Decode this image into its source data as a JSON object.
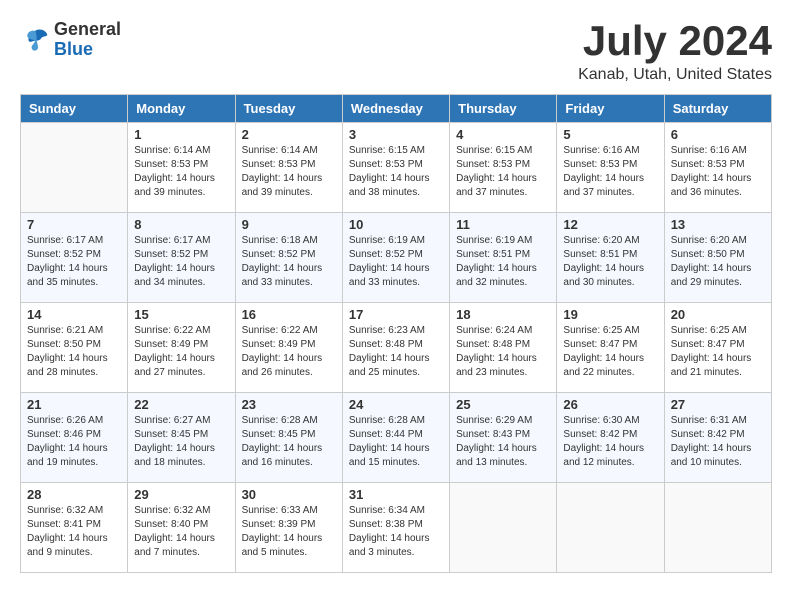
{
  "header": {
    "logo_general": "General",
    "logo_blue": "Blue",
    "title": "July 2024",
    "location": "Kanab, Utah, United States"
  },
  "days_of_week": [
    "Sunday",
    "Monday",
    "Tuesday",
    "Wednesday",
    "Thursday",
    "Friday",
    "Saturday"
  ],
  "weeks": [
    [
      {
        "day": "",
        "sunrise": "",
        "sunset": "",
        "daylight": ""
      },
      {
        "day": "1",
        "sunrise": "Sunrise: 6:14 AM",
        "sunset": "Sunset: 8:53 PM",
        "daylight": "Daylight: 14 hours and 39 minutes."
      },
      {
        "day": "2",
        "sunrise": "Sunrise: 6:14 AM",
        "sunset": "Sunset: 8:53 PM",
        "daylight": "Daylight: 14 hours and 39 minutes."
      },
      {
        "day": "3",
        "sunrise": "Sunrise: 6:15 AM",
        "sunset": "Sunset: 8:53 PM",
        "daylight": "Daylight: 14 hours and 38 minutes."
      },
      {
        "day": "4",
        "sunrise": "Sunrise: 6:15 AM",
        "sunset": "Sunset: 8:53 PM",
        "daylight": "Daylight: 14 hours and 37 minutes."
      },
      {
        "day": "5",
        "sunrise": "Sunrise: 6:16 AM",
        "sunset": "Sunset: 8:53 PM",
        "daylight": "Daylight: 14 hours and 37 minutes."
      },
      {
        "day": "6",
        "sunrise": "Sunrise: 6:16 AM",
        "sunset": "Sunset: 8:53 PM",
        "daylight": "Daylight: 14 hours and 36 minutes."
      }
    ],
    [
      {
        "day": "7",
        "sunrise": "Sunrise: 6:17 AM",
        "sunset": "Sunset: 8:52 PM",
        "daylight": "Daylight: 14 hours and 35 minutes."
      },
      {
        "day": "8",
        "sunrise": "Sunrise: 6:17 AM",
        "sunset": "Sunset: 8:52 PM",
        "daylight": "Daylight: 14 hours and 34 minutes."
      },
      {
        "day": "9",
        "sunrise": "Sunrise: 6:18 AM",
        "sunset": "Sunset: 8:52 PM",
        "daylight": "Daylight: 14 hours and 33 minutes."
      },
      {
        "day": "10",
        "sunrise": "Sunrise: 6:19 AM",
        "sunset": "Sunset: 8:52 PM",
        "daylight": "Daylight: 14 hours and 33 minutes."
      },
      {
        "day": "11",
        "sunrise": "Sunrise: 6:19 AM",
        "sunset": "Sunset: 8:51 PM",
        "daylight": "Daylight: 14 hours and 32 minutes."
      },
      {
        "day": "12",
        "sunrise": "Sunrise: 6:20 AM",
        "sunset": "Sunset: 8:51 PM",
        "daylight": "Daylight: 14 hours and 30 minutes."
      },
      {
        "day": "13",
        "sunrise": "Sunrise: 6:20 AM",
        "sunset": "Sunset: 8:50 PM",
        "daylight": "Daylight: 14 hours and 29 minutes."
      }
    ],
    [
      {
        "day": "14",
        "sunrise": "Sunrise: 6:21 AM",
        "sunset": "Sunset: 8:50 PM",
        "daylight": "Daylight: 14 hours and 28 minutes."
      },
      {
        "day": "15",
        "sunrise": "Sunrise: 6:22 AM",
        "sunset": "Sunset: 8:49 PM",
        "daylight": "Daylight: 14 hours and 27 minutes."
      },
      {
        "day": "16",
        "sunrise": "Sunrise: 6:22 AM",
        "sunset": "Sunset: 8:49 PM",
        "daylight": "Daylight: 14 hours and 26 minutes."
      },
      {
        "day": "17",
        "sunrise": "Sunrise: 6:23 AM",
        "sunset": "Sunset: 8:48 PM",
        "daylight": "Daylight: 14 hours and 25 minutes."
      },
      {
        "day": "18",
        "sunrise": "Sunrise: 6:24 AM",
        "sunset": "Sunset: 8:48 PM",
        "daylight": "Daylight: 14 hours and 23 minutes."
      },
      {
        "day": "19",
        "sunrise": "Sunrise: 6:25 AM",
        "sunset": "Sunset: 8:47 PM",
        "daylight": "Daylight: 14 hours and 22 minutes."
      },
      {
        "day": "20",
        "sunrise": "Sunrise: 6:25 AM",
        "sunset": "Sunset: 8:47 PM",
        "daylight": "Daylight: 14 hours and 21 minutes."
      }
    ],
    [
      {
        "day": "21",
        "sunrise": "Sunrise: 6:26 AM",
        "sunset": "Sunset: 8:46 PM",
        "daylight": "Daylight: 14 hours and 19 minutes."
      },
      {
        "day": "22",
        "sunrise": "Sunrise: 6:27 AM",
        "sunset": "Sunset: 8:45 PM",
        "daylight": "Daylight: 14 hours and 18 minutes."
      },
      {
        "day": "23",
        "sunrise": "Sunrise: 6:28 AM",
        "sunset": "Sunset: 8:45 PM",
        "daylight": "Daylight: 14 hours and 16 minutes."
      },
      {
        "day": "24",
        "sunrise": "Sunrise: 6:28 AM",
        "sunset": "Sunset: 8:44 PM",
        "daylight": "Daylight: 14 hours and 15 minutes."
      },
      {
        "day": "25",
        "sunrise": "Sunrise: 6:29 AM",
        "sunset": "Sunset: 8:43 PM",
        "daylight": "Daylight: 14 hours and 13 minutes."
      },
      {
        "day": "26",
        "sunrise": "Sunrise: 6:30 AM",
        "sunset": "Sunset: 8:42 PM",
        "daylight": "Daylight: 14 hours and 12 minutes."
      },
      {
        "day": "27",
        "sunrise": "Sunrise: 6:31 AM",
        "sunset": "Sunset: 8:42 PM",
        "daylight": "Daylight: 14 hours and 10 minutes."
      }
    ],
    [
      {
        "day": "28",
        "sunrise": "Sunrise: 6:32 AM",
        "sunset": "Sunset: 8:41 PM",
        "daylight": "Daylight: 14 hours and 9 minutes."
      },
      {
        "day": "29",
        "sunrise": "Sunrise: 6:32 AM",
        "sunset": "Sunset: 8:40 PM",
        "daylight": "Daylight: 14 hours and 7 minutes."
      },
      {
        "day": "30",
        "sunrise": "Sunrise: 6:33 AM",
        "sunset": "Sunset: 8:39 PM",
        "daylight": "Daylight: 14 hours and 5 minutes."
      },
      {
        "day": "31",
        "sunrise": "Sunrise: 6:34 AM",
        "sunset": "Sunset: 8:38 PM",
        "daylight": "Daylight: 14 hours and 3 minutes."
      },
      {
        "day": "",
        "sunrise": "",
        "sunset": "",
        "daylight": ""
      },
      {
        "day": "",
        "sunrise": "",
        "sunset": "",
        "daylight": ""
      },
      {
        "day": "",
        "sunrise": "",
        "sunset": "",
        "daylight": ""
      }
    ]
  ]
}
